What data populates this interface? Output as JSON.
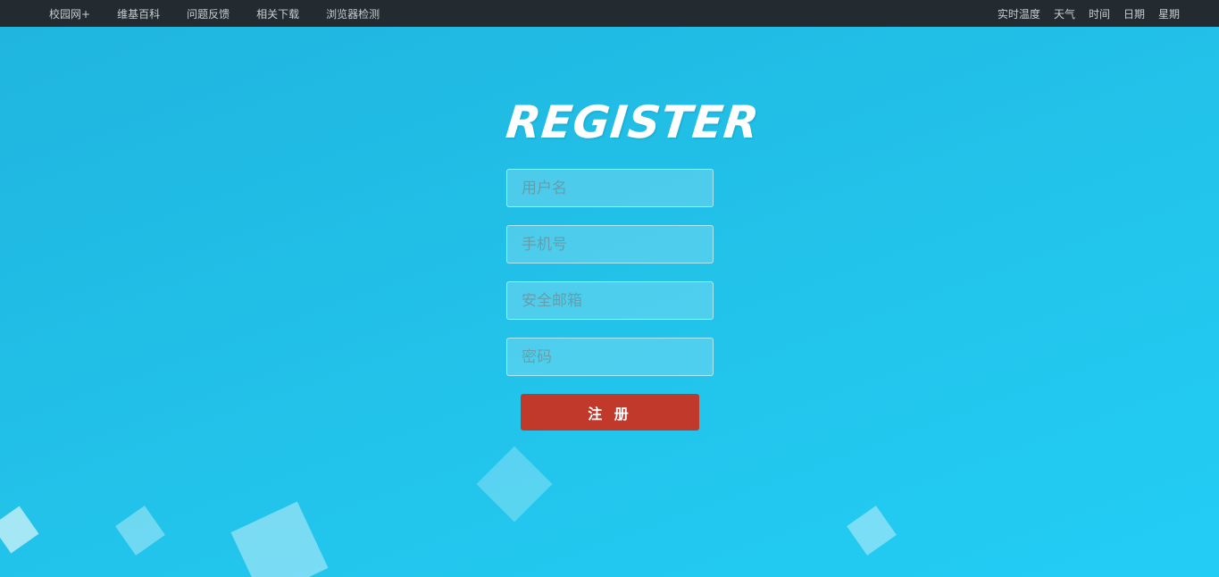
{
  "nav": {
    "left": [
      "校园网+",
      "维基百科",
      "问题反馈",
      "相关下载",
      "浏览器检测"
    ],
    "right": [
      "实时温度",
      "天气",
      "时间",
      "日期",
      "星期"
    ]
  },
  "form": {
    "title": "REGISTER",
    "username_placeholder": "用户名",
    "phone_placeholder": "手机号",
    "email_placeholder": "安全邮箱",
    "password_placeholder": "密码",
    "submit_label": "注 册"
  },
  "colors": {
    "background": "#22c3ea",
    "topbar": "#232a30",
    "submit": "#c0392b"
  }
}
